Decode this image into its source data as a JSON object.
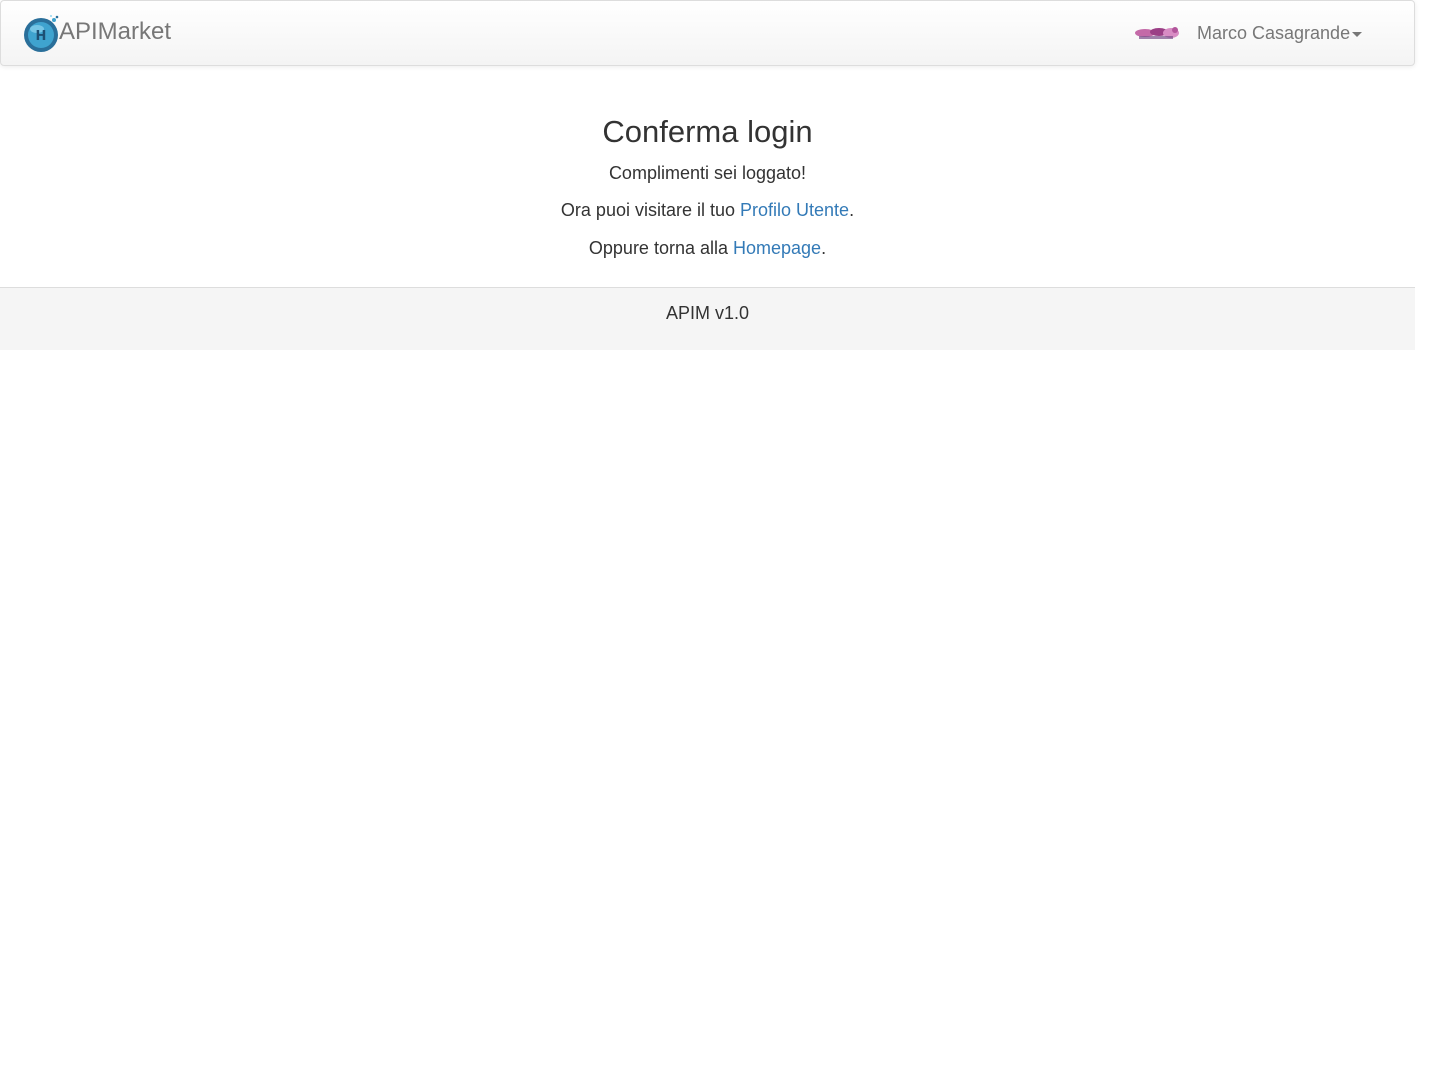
{
  "navbar": {
    "brand_label": "APIMarket",
    "logo_icon": "apimarket-logo-icon",
    "avatar_icon": "user-avatar-icon",
    "user_name": "Marco Casagrande",
    "dropdown_icon": "caret-down-icon"
  },
  "main": {
    "title": "Conferma login",
    "message": "Complimenti sei loggato!",
    "profile_prefix": "Ora puoi visitare il tuo ",
    "profile_link": "Profilo Utente",
    "profile_suffix": ".",
    "home_prefix": "Oppure torna alla ",
    "home_link": "Homepage",
    "home_suffix": "."
  },
  "footer": {
    "version": "APIM v1.0"
  },
  "colors": {
    "link": "#337ab7",
    "text": "#333333",
    "muted": "#777777",
    "footer_bg": "#f5f5f5"
  }
}
